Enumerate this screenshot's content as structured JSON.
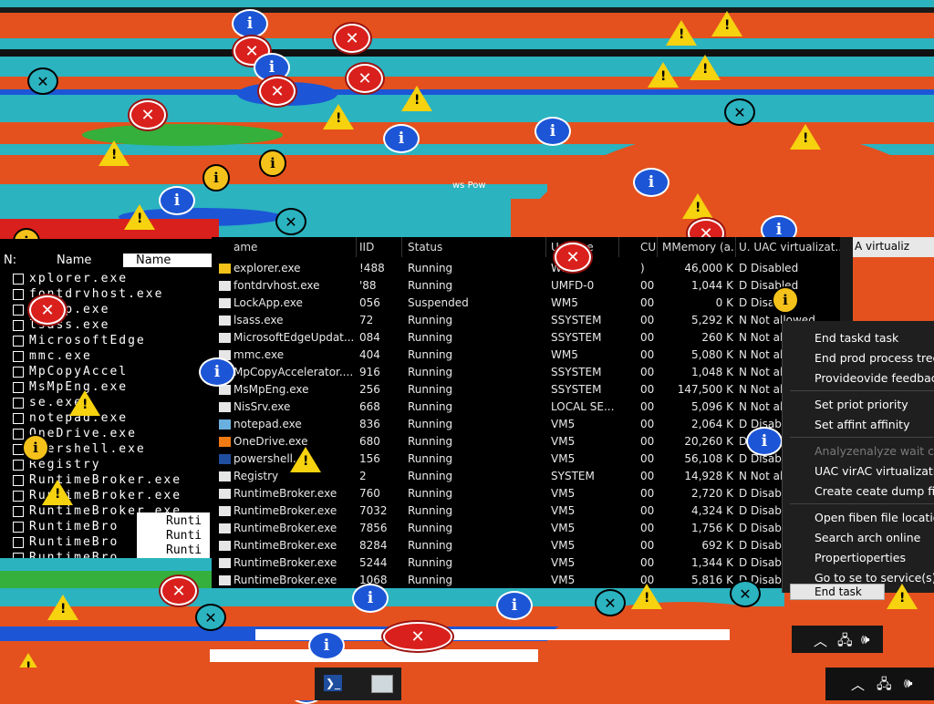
{
  "ghost_list": {
    "header_col1": "N:",
    "header_col2": "Name",
    "header_selected": "Name",
    "items": [
      "xplorer.exe",
      "fontdrvhost.exe",
      "ckApp.exe",
      "lsass.exe",
      "MicrosoftEdge",
      "mmc.exe",
      "MpCopyAccel",
      "MsMpEng.exe",
      "se.exe",
      "notepad.exe",
      "OneDrive.exe",
      "owershell.exe",
      "Registry",
      "RuntimeBroker.exe",
      "RuntimeBroker.exe",
      "RuntimeBroker.exe",
      "RuntimeBro",
      "RuntimeBro",
      "RuntimeBro"
    ],
    "small_items": [
      "Runti",
      "Runti",
      "Runti",
      "Runti"
    ]
  },
  "table": {
    "headers": {
      "name": "ame",
      "pid": "IID",
      "status": "Status",
      "user": "U  name",
      "cpu": "CU",
      "memory": "MMemory (a...",
      "uac": "U. UAC virtualizat..."
    },
    "rows": [
      {
        "icon": "explorer-icon",
        "name": "explorer.exe",
        "pid": "!488",
        "status": "Running",
        "user": "WM5",
        "cpu": ")",
        "mem": "46,000 K",
        "uac": "D Disabled"
      },
      {
        "icon": "app-icon",
        "name": "fontdrvhost.exe",
        "pid": "'88",
        "status": "Running",
        "user": "UMFD-0",
        "cpu": "00",
        "mem": "1,044 K",
        "uac": "D Disabled"
      },
      {
        "icon": "app-icon",
        "name": "LockApp.exe",
        "pid": "056",
        "status": "Suspended",
        "user": "WM5",
        "cpu": "00",
        "mem": "0 K",
        "uac": "D Disabled"
      },
      {
        "icon": "app-icon",
        "name": "lsass.exe",
        "pid": "72",
        "status": "Running",
        "user": "SSYSTEM",
        "cpu": "00",
        "mem": "5,292 K",
        "uac": "N Not allowed"
      },
      {
        "icon": "app-icon",
        "name": "MicrosoftEdgeUpdat...",
        "pid": "084",
        "status": "Running",
        "user": "SSYSTEM",
        "cpu": "00",
        "mem": "260 K",
        "uac": "N Not all"
      },
      {
        "icon": "app-icon",
        "name": "mmc.exe",
        "pid": "404",
        "status": "Running",
        "user": "WM5",
        "cpu": "00",
        "mem": "5,080 K",
        "uac": "N Not all"
      },
      {
        "icon": "shield-icon",
        "name": "MpCopyAccelerator....",
        "pid": "916",
        "status": "Running",
        "user": "SSYSTEM",
        "cpu": "00",
        "mem": "1,048 K",
        "uac": "N Not all"
      },
      {
        "icon": "app-icon",
        "name": "MsMpEng.exe",
        "pid": "256",
        "status": "Running",
        "user": "SSYSTEM",
        "cpu": "00",
        "mem": "147,500 K",
        "uac": "N Not all"
      },
      {
        "icon": "app-icon",
        "name": "NisSrv.exe",
        "pid": "668",
        "status": "Running",
        "user": "LOCAL SE...",
        "cpu": "00",
        "mem": "5,096 K",
        "uac": "N Not all"
      },
      {
        "icon": "notepad-icon",
        "name": "notepad.exe",
        "pid": "836",
        "status": "Running",
        "user": "VM5",
        "cpu": "00",
        "mem": "2,064 K",
        "uac": "D Disable"
      },
      {
        "icon": "cloud-icon",
        "name": "OneDrive.exe",
        "pid": "680",
        "status": "Running",
        "user": "VM5",
        "cpu": "00",
        "mem": "20,260 K",
        "uac": "D Disable"
      },
      {
        "icon": "powershell-icon",
        "name": "powershell.",
        "pid": "156",
        "status": "Running",
        "user": "VM5",
        "cpu": "00",
        "mem": "56,108 K",
        "uac": "D Disable"
      },
      {
        "icon": "app-icon",
        "name": "Registry",
        "pid": "2",
        "status": "Running",
        "user": "SYSTEM",
        "cpu": "00",
        "mem": "14,928 K",
        "uac": "N Not all"
      },
      {
        "icon": "app-icon",
        "name": "RuntimeBroker.exe",
        "pid": "760",
        "status": "Running",
        "user": "VM5",
        "cpu": "00",
        "mem": "2,720 K",
        "uac": "D Disable"
      },
      {
        "icon": "app-icon",
        "name": "RuntimeBroker.exe",
        "pid": "7032",
        "status": "Running",
        "user": "VM5",
        "cpu": "00",
        "mem": "4,324 K",
        "uac": "D Disable"
      },
      {
        "icon": "app-icon",
        "name": "RuntimeBroker.exe",
        "pid": "7856",
        "status": "Running",
        "user": "VM5",
        "cpu": "00",
        "mem": "1,756 K",
        "uac": "D Disable"
      },
      {
        "icon": "app-icon",
        "name": "RuntimeBroker.exe",
        "pid": "8284",
        "status": "Running",
        "user": "VM5",
        "cpu": "00",
        "mem": "692 K",
        "uac": "D Disable"
      },
      {
        "icon": "app-icon",
        "name": "RuntimeBroker.exe",
        "pid": "5244",
        "status": "Running",
        "user": "VM5",
        "cpu": "00",
        "mem": "1,344 K",
        "uac": "D Disable"
      },
      {
        "icon": "app-icon",
        "name": "RuntimeBroker.exe",
        "pid": "1068",
        "status": "Running",
        "user": "VM5",
        "cpu": "00",
        "mem": "5,816 K",
        "uac": "D Disable"
      }
    ]
  },
  "right_strip": {
    "text": "A  virtualiz"
  },
  "context_menu": {
    "items": [
      {
        "label": "End taskd task",
        "disabled": false
      },
      {
        "label": "End prod process tree",
        "disabled": false
      },
      {
        "label": "Provideovide feedback",
        "disabled": false
      },
      {
        "label": "Set priot priority",
        "disabled": false
      },
      {
        "label": "Set affint affinity",
        "disabled": false
      },
      {
        "label": "Analyzenalyze wait cha",
        "disabled": true
      },
      {
        "label": "UAC virAC virtualization",
        "disabled": false
      },
      {
        "label": "Create ceate dump file",
        "disabled": false
      },
      {
        "label": "Open fiben file locatio",
        "disabled": false
      },
      {
        "label": "Search arch online",
        "disabled": false
      },
      {
        "label": "Propertioperties",
        "disabled": false
      },
      {
        "label": "Go to se to service(s)",
        "disabled": false
      }
    ]
  },
  "end_task_button": {
    "label": "End task"
  },
  "desktop_text": {
    "fragment": "ws Pow"
  },
  "colors": {
    "background": "#e4511e",
    "cyan": "#2bb3c0",
    "black": "#000000",
    "menu": "#1f1f1f"
  }
}
